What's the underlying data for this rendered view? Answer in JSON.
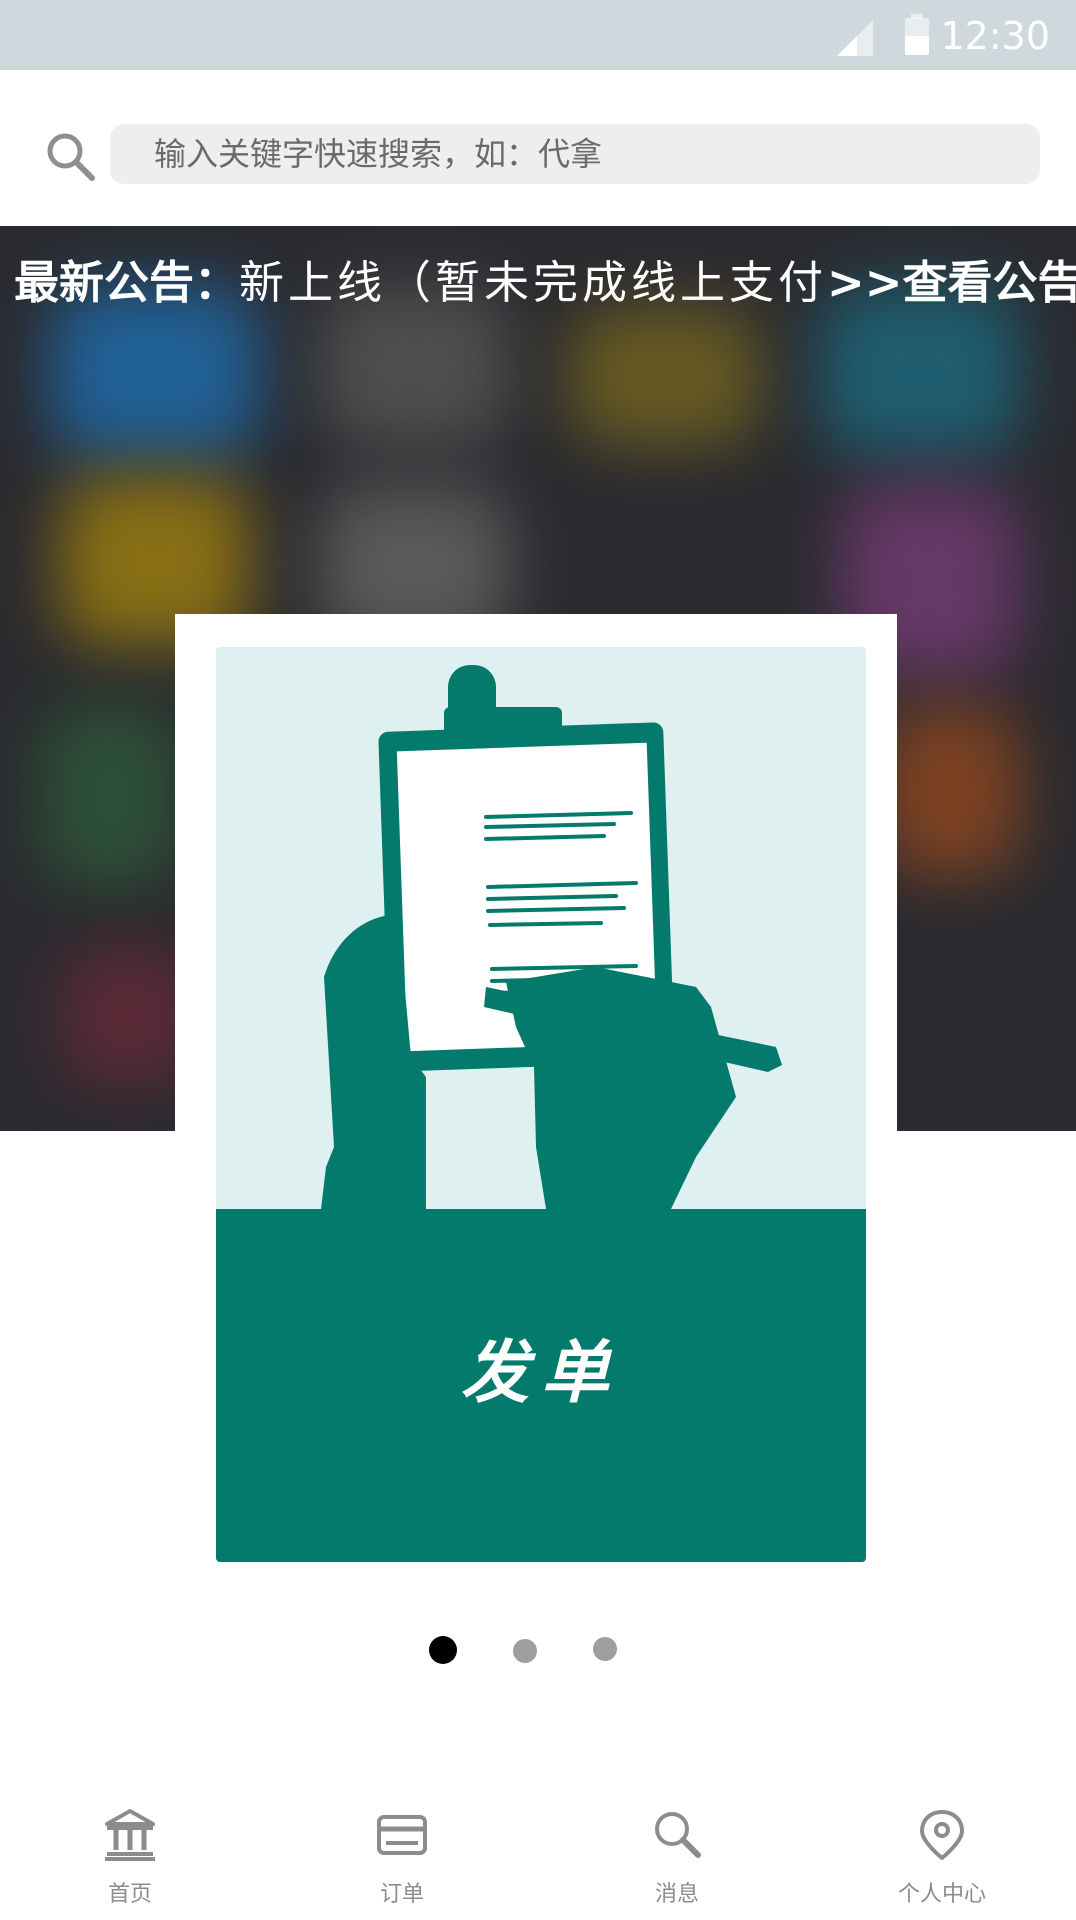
{
  "status_bar": {
    "time": "12:30"
  },
  "search": {
    "placeholder": "输入关键字快速搜索，如：代拿"
  },
  "notice": {
    "label": "最新公告：",
    "text": "新上线（暂未完成线上支付",
    "link": ">>查看公告"
  },
  "card": {
    "title": "发单"
  },
  "carousel": {
    "page_count": 3,
    "active_index": 0
  },
  "tabs": [
    {
      "label": "首页",
      "icon": "bank-icon"
    },
    {
      "label": "订单",
      "icon": "card-icon"
    },
    {
      "label": "消息",
      "icon": "search-icon"
    },
    {
      "label": "个人中心",
      "icon": "location-pin-icon"
    }
  ],
  "colors": {
    "accent": "#047a6c",
    "illustration_bg": "#dff0f0",
    "status_bar": "#cfd8dc"
  }
}
